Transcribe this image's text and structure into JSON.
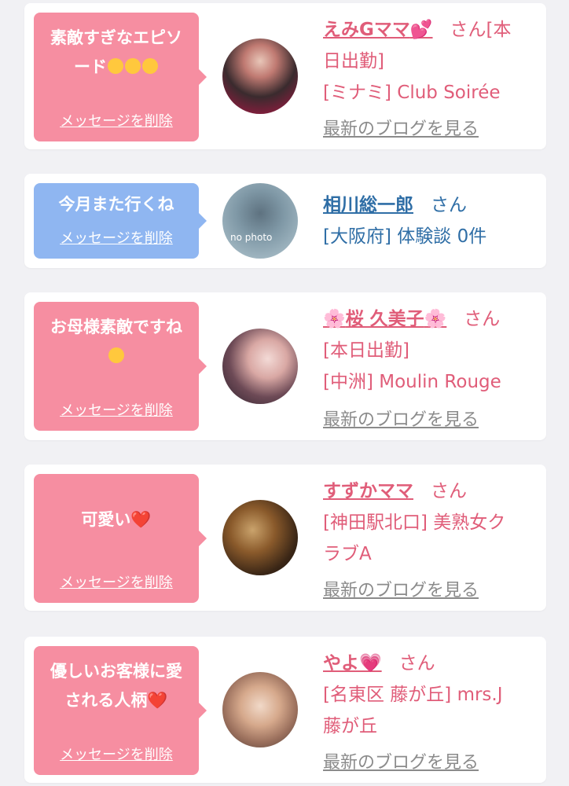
{
  "delete_label": "メッセージを削除",
  "blog_label": "最新のブログを見る",
  "san_label": "さん",
  "cards": [
    {
      "message_line1": "素敵すぎなエピソ",
      "message_line2": "ード",
      "name": "えみGママ",
      "name_emoji": "💕",
      "detail1": "[本",
      "detail2": "日出勤]",
      "detail3": "[ミナミ] Club Soirée"
    },
    {
      "message_line1": "今月また行くね",
      "name": "相川総一郎",
      "detail1": "[大阪府] 体験談 0件",
      "avatar_text": "no photo"
    },
    {
      "message_line1": "お母様素敵ですね",
      "name": "桜 久美子",
      "flower": "🌸",
      "detail1": "[本日出勤]",
      "detail2": "[中洲] Moulin Rouge"
    },
    {
      "message_line1": "可愛い",
      "heart": "❤️",
      "name": "すずかママ",
      "detail1": "[神田駅北口] 美熟女ク",
      "detail2": "ラブA"
    },
    {
      "message_line1": "優しいお客様に愛",
      "message_line2": "される人柄",
      "heart": "❤️",
      "name": "やよ",
      "name_emoji": "💗",
      "detail1": "[名東区 藤が丘] mrs.J",
      "detail2": "藤が丘"
    }
  ],
  "colors": {
    "pink_bubble": "#f68ea1",
    "blue_bubble": "#8fb6f1",
    "pink_text": "#e05d79",
    "blue_text": "#2f6ea6",
    "link_gray": "#8b8b8b"
  }
}
